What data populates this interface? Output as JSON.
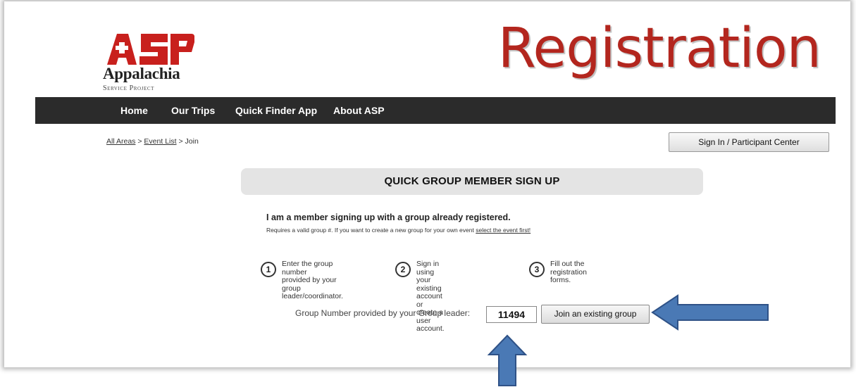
{
  "brand": {
    "logo_name": "Appalachia",
    "logo_sub": "Service Project"
  },
  "page_title": "Registration",
  "nav": {
    "items": [
      {
        "label": "Home"
      },
      {
        "label": "Our Trips"
      },
      {
        "label": "Quick Finder App"
      },
      {
        "label": "About ASP"
      }
    ]
  },
  "breadcrumb": {
    "all_areas": "All Areas",
    "sep1": ">",
    "event_list": "Event List",
    "sep2": ">",
    "current": "Join"
  },
  "signin_label": "Sign In / Participant Center",
  "section_header": "QUICK GROUP MEMBER SIGN UP",
  "intro": {
    "title": "I am a member signing up with a group already registered.",
    "sub_prefix": "Requires a valid group #. If you want to create a new group for your own event",
    "sub_link": "select the event first!"
  },
  "steps": [
    {
      "number": "1",
      "lines": [
        "Enter the group number",
        "provided by your group",
        "leader/coordinator."
      ]
    },
    {
      "number": "2",
      "lines": [
        "Sign in using your existing",
        "account or create a user",
        "account."
      ]
    },
    {
      "number": "3",
      "lines": [
        "Fill out the registration",
        "forms."
      ]
    }
  ],
  "group_form": {
    "label": "Group Number provided by your Group leader:",
    "value": "11494",
    "button": "Join an existing group"
  },
  "colors": {
    "brand_red": "#b3261e",
    "nav_bg": "#2b2b2b",
    "arrow_fill": "#4a79b5"
  }
}
